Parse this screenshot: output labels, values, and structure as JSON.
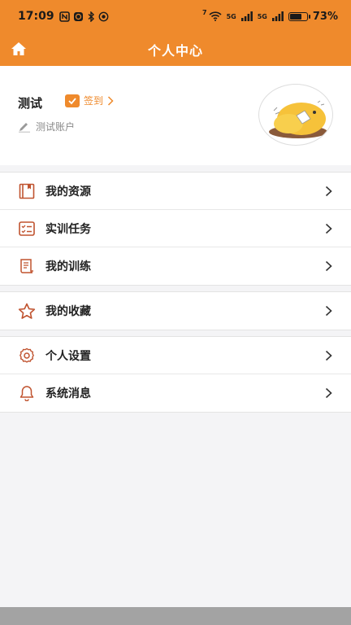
{
  "status_bar": {
    "time": "17:09",
    "left_icons": [
      "nfc-icon",
      "alarm-icon",
      "bluetooth-icon",
      "location-icon"
    ],
    "wifi_label": "7",
    "signal1_label": "5G",
    "signal2_label": "5G",
    "battery_percent": "73%",
    "battery_level": 0.73
  },
  "nav": {
    "title": "个人中心",
    "home_icon": "home-icon"
  },
  "profile": {
    "name": "测试",
    "signin_label": "签到",
    "account_label": "测试账户"
  },
  "menu": {
    "group1": [
      {
        "label": "我的资源",
        "icon": "book-icon"
      },
      {
        "label": "实训任务",
        "icon": "task-list-icon"
      },
      {
        "label": "我的训练",
        "icon": "scroll-icon"
      }
    ],
    "group2": [
      {
        "label": "我的收藏",
        "icon": "star-icon"
      }
    ],
    "group3": [
      {
        "label": "个人设置",
        "icon": "gear-icon"
      },
      {
        "label": "系统消息",
        "icon": "bell-icon"
      }
    ]
  },
  "colors": {
    "accent": "#ef8a2c",
    "icon": "#c0532f"
  }
}
